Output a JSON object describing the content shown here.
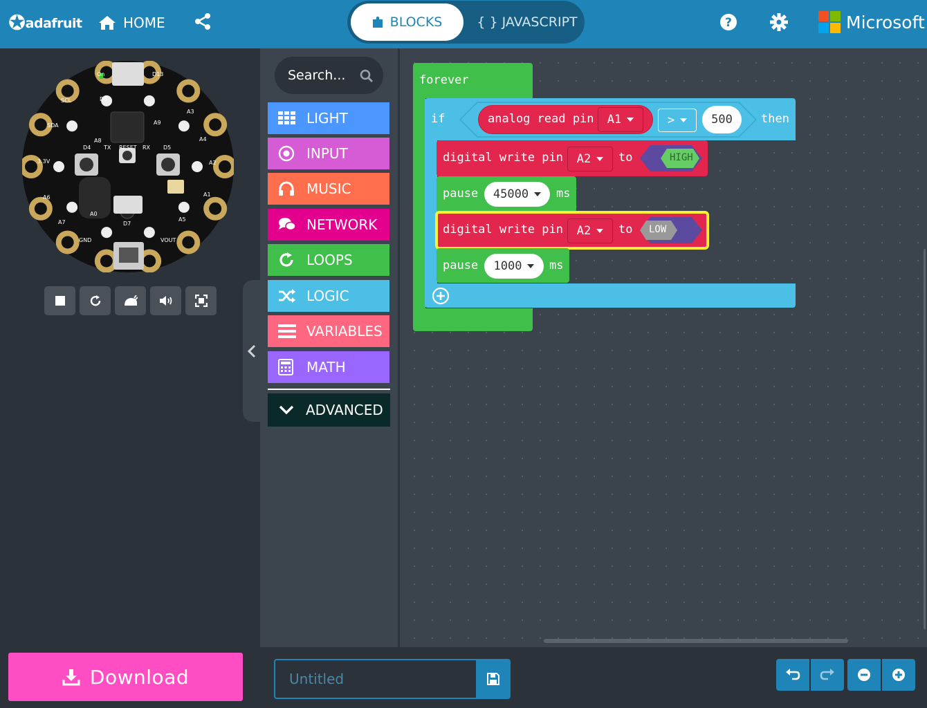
{
  "brand": {
    "logo": "adafruit",
    "partner": "Microsoft"
  },
  "header": {
    "home": "HOME",
    "tab_blocks": "BLOCKS",
    "tab_js": "{ } JAVASCRIPT"
  },
  "search": {
    "placeholder": "Search..."
  },
  "categories": [
    {
      "label": "LIGHT",
      "color": "#4c97ff",
      "icon": "grid-icon"
    },
    {
      "label": "INPUT",
      "color": "#d65cd6",
      "icon": "target-icon"
    },
    {
      "label": "MUSIC",
      "color": "#ff6f4d",
      "icon": "headphones-icon"
    },
    {
      "label": "NETWORK",
      "color": "#e3008c",
      "icon": "chat-icon"
    },
    {
      "label": "LOOPS",
      "color": "#40bf4a",
      "icon": "refresh-icon"
    },
    {
      "label": "LOGIC",
      "color": "#4cbfe6",
      "icon": "shuffle-icon"
    },
    {
      "label": "VARIABLES",
      "color": "#ff6680",
      "icon": "list-icon"
    },
    {
      "label": "MATH",
      "color": "#9966ff",
      "icon": "calculator-icon"
    }
  ],
  "advanced": "ADVANCED",
  "blocks": {
    "forever": "forever",
    "if": "if",
    "then": "then",
    "analog_read": "analog read pin",
    "pin_a1": "A1",
    "compare_op": ">",
    "threshold": "500",
    "digital_write": "digital write pin",
    "pin_a2": "A2",
    "to": "to",
    "high": "HIGH",
    "low": "LOW",
    "pause": "pause",
    "pause1_value": "45000",
    "pause2_value": "1000",
    "ms": "ms"
  },
  "bottom": {
    "download": "Download",
    "project_placeholder": "Untitled"
  },
  "board_labels": {
    "usb": "D13",
    "on": "On",
    "d8": "D8",
    "a9": "A9",
    "a8": "A8",
    "d4": "D4",
    "tx": "TX",
    "reset": "RESET",
    "rx": "RX",
    "d5": "D5",
    "a0": "A0",
    "d7": "D7",
    "gnd": "GND",
    "v33": "3.3V",
    "scl": "SCL",
    "a3": "A3",
    "sda": "SDA",
    "a4": "A4",
    "a2": "A2",
    "a1": "A1",
    "a6": "A6",
    "a7": "A7",
    "vout": "VOUT",
    "a5": "A5"
  }
}
